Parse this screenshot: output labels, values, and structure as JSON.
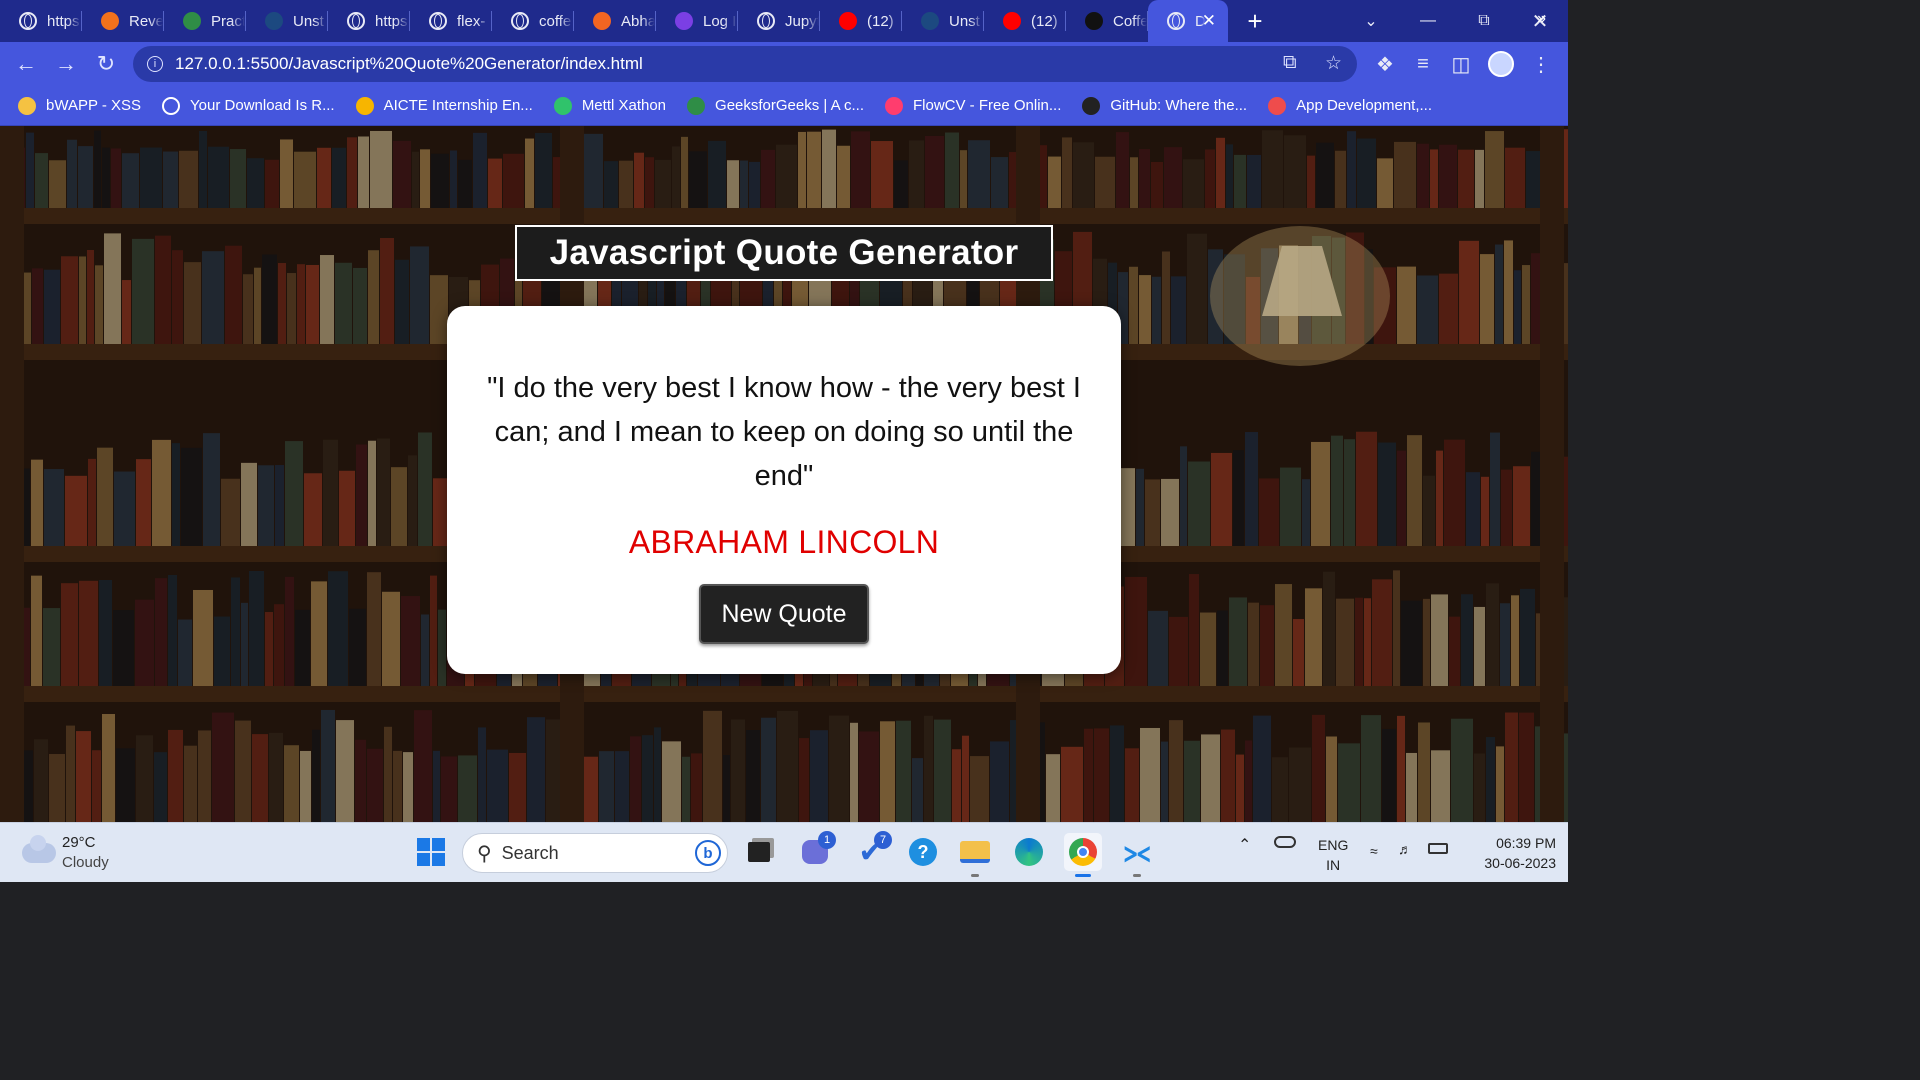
{
  "browser": {
    "tabs": [
      {
        "title": "https",
        "icon": "globe-icon",
        "color": "#ffffff"
      },
      {
        "title": "Reve",
        "icon": "reverso-icon",
        "color": "#f2711c"
      },
      {
        "title": "Pract",
        "icon": "geeksforgeeks-icon",
        "color": "#2f8d46"
      },
      {
        "title": "Unst",
        "icon": "unstop-icon",
        "color": "#1c4980"
      },
      {
        "title": "https",
        "icon": "globe-icon",
        "color": "#ffffff"
      },
      {
        "title": "flex-",
        "icon": "globe-icon",
        "color": "#ffffff"
      },
      {
        "title": "coffe",
        "icon": "globe-icon",
        "color": "#ffffff"
      },
      {
        "title": "Abha",
        "icon": "abha-icon",
        "color": "#f26522"
      },
      {
        "title": "Log I",
        "icon": "login-icon",
        "color": "#7b3fe4"
      },
      {
        "title": "Jupyt",
        "icon": "globe-icon",
        "color": "#ffffff"
      },
      {
        "title": "(12)",
        "icon": "youtube-icon",
        "color": "#ff0000"
      },
      {
        "title": "Unst",
        "icon": "unstop-icon",
        "color": "#1c4980"
      },
      {
        "title": "(12)",
        "icon": "youtube-icon",
        "color": "#ff0000"
      },
      {
        "title": "Coffe",
        "icon": "coffee-icon",
        "color": "#111111"
      },
      {
        "title": "D",
        "icon": "globe-icon",
        "color": "#ffffff",
        "active": true
      }
    ],
    "new_tab": "+",
    "address": {
      "url": "127.0.0.1:5500/Javascript%20Quote%20Generator/index.html"
    },
    "bookmarks": [
      {
        "label": "bWAPP - XSS",
        "icon": "bee-icon",
        "color": "#f5c242"
      },
      {
        "label": "Your Download Is R...",
        "icon": "globe-icon",
        "color": "#ffffff"
      },
      {
        "label": "AICTE Internship En...",
        "icon": "aicte-icon",
        "color": "#f7b500"
      },
      {
        "label": "Mettl Xathon",
        "icon": "mettl-icon",
        "color": "#30c36b"
      },
      {
        "label": "GeeksforGeeks | A c...",
        "icon": "geeksforgeeks-icon",
        "color": "#2f8d46"
      },
      {
        "label": "FlowCV - Free Onlin...",
        "icon": "flowcv-icon",
        "color": "#ff3d6e"
      },
      {
        "label": "GitHub: Where the...",
        "icon": "github-icon",
        "color": "#222222"
      },
      {
        "label": "App Development,...",
        "icon": "h-icon",
        "color": "#ef4c4c"
      }
    ],
    "bookmarks_more": "»"
  },
  "page": {
    "title": "Javascript Quote Generator",
    "quote": "\"I do the very best I know how - the very best I can; and I mean to keep on doing so until the end\"",
    "author": "ABRAHAM LINCOLN",
    "button_label": "New Quote",
    "author_color": "#e00000"
  },
  "taskbar": {
    "weather": {
      "temp": "29°C",
      "condition": "Cloudy"
    },
    "search_placeholder": "Search",
    "badges": {
      "teams": "1",
      "todo": "7"
    },
    "tray": {
      "lang": "ENG",
      "region": "IN"
    },
    "clock": {
      "time": "06:39 PM",
      "date": "30-06-2023"
    }
  }
}
